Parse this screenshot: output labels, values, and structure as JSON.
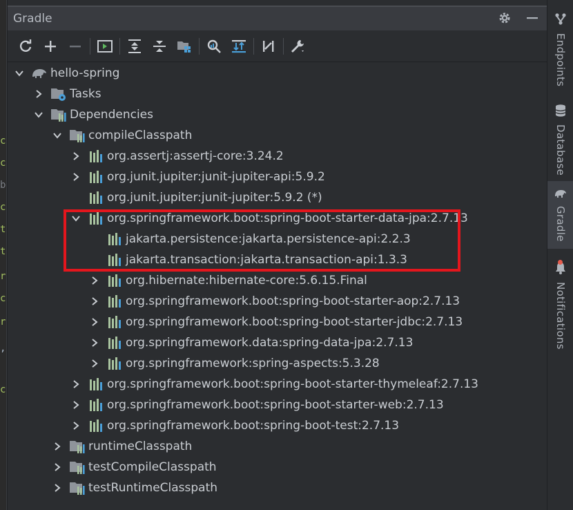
{
  "panel": {
    "title": "Gradle"
  },
  "title_actions": [
    {
      "icon": "gear-icon"
    },
    {
      "icon": "minimize-icon"
    }
  ],
  "toolbar": [
    {
      "icon": "reload-icon"
    },
    {
      "icon": "add-icon"
    },
    {
      "icon": "remove-icon"
    },
    {
      "icon": "run-task-icon"
    },
    {
      "icon": "expand-all-icon"
    },
    {
      "icon": "collapse-all-icon"
    },
    {
      "icon": "group-modules-icon"
    },
    {
      "icon": "analyze-dependencies-icon"
    },
    {
      "icon": "show-dependencies-icon"
    },
    {
      "icon": "toggle-offline-icon"
    },
    {
      "icon": "build-settings-icon"
    }
  ],
  "tree": {
    "project": "hello-spring",
    "tasks": "Tasks",
    "dependencies": "Dependencies",
    "compile_classpath": "compileClasspath",
    "dep1": "org.assertj:assertj-core:3.24.2",
    "dep2": "org.junit.jupiter:junit-jupiter-api:5.9.2",
    "dep3": "org.junit.jupiter:junit-jupiter:5.9.2 (*)",
    "dep4": "org.springframework.boot:spring-boot-starter-data-jpa:2.7.13",
    "dep4_1": "jakarta.persistence:jakarta.persistence-api:2.2.3",
    "dep4_2": "jakarta.transaction:jakarta.transaction-api:1.3.3",
    "dep4_3": "org.hibernate:hibernate-core:5.6.15.Final",
    "dep4_4": "org.springframework.boot:spring-boot-starter-aop:2.7.13",
    "dep4_5": "org.springframework.boot:spring-boot-starter-jdbc:2.7.13",
    "dep4_6": "org.springframework.data:spring-data-jpa:2.7.13",
    "dep4_7": "org.springframework:spring-aspects:5.3.28",
    "dep5": "org.springframework.boot:spring-boot-starter-thymeleaf:2.7.13",
    "dep6": "org.springframework.boot:spring-boot-starter-web:2.7.13",
    "dep7": "org.springframework.boot:spring-boot-test:2.7.13",
    "runtime_classpath": "runtimeClasspath",
    "test_compile_classpath": "testCompileClasspath",
    "test_runtime_classpath": "testRuntimeClasspath"
  },
  "right_stripe": {
    "endpoints": "Endpoints",
    "database": "Database",
    "gradle": "Gradle",
    "notifications": "Notifications"
  },
  "editor_glyphs": [
    "c",
    "c",
    "b",
    "c",
    "t",
    "t",
    "r",
    "c",
    "r",
    ",",
    "c"
  ],
  "colors": {
    "highlight": "#e3161d",
    "library_icon": "#a9c4a0",
    "accent_blue": "#4a9fd8"
  }
}
